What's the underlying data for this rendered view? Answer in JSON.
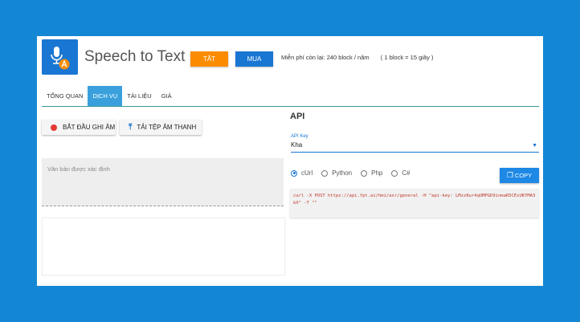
{
  "header": {
    "title": "Speech to Text",
    "off_button": "TẮT",
    "buy_button": "MUA",
    "quota_text": "Miễn phí còn lại: 240 block / năm",
    "block_note": "( 1 block = 15 giây )"
  },
  "tabs": [
    {
      "label": "TỔNG QUAN",
      "active": false
    },
    {
      "label": "DỊCH VỤ",
      "active": true
    },
    {
      "label": "TÀI LIỆU",
      "active": false
    },
    {
      "label": "GIÁ",
      "active": false
    }
  ],
  "actions": {
    "record_label": "BẮT ĐẦU GHI ÂM",
    "upload_label": "TẢI TỆP ÂM THANH"
  },
  "transcript": {
    "placeholder": "Văn bản được xác định"
  },
  "api": {
    "title": "API",
    "key_label": "API Key",
    "key_value": "Kha",
    "languages": [
      {
        "label": "cUrl",
        "selected": true
      },
      {
        "label": "Python",
        "selected": false
      },
      {
        "label": "Php",
        "selected": false
      },
      {
        "label": "C#",
        "selected": false
      }
    ],
    "copy_label": "COPY",
    "code": "curl -X POST https://api.fpt.ai/hmi/asr/general -H \"api-key: LMzz8ur4qUMPGD9inmaR5CEsUKYMA3kX\" -T \"\""
  },
  "colors": {
    "background": "#1487d4",
    "primary": "#1976d2",
    "accent_orange": "#fb8c00",
    "tab_active": "#3aa0dc",
    "record_dot": "#e53935",
    "code_text": "#c0392b"
  },
  "icons": {
    "app_logo": "microphone-translate-icon",
    "record": "record-dot-icon",
    "upload": "upload-arrow-icon",
    "copy": "copy-icon",
    "dropdown": "caret-down-icon"
  }
}
